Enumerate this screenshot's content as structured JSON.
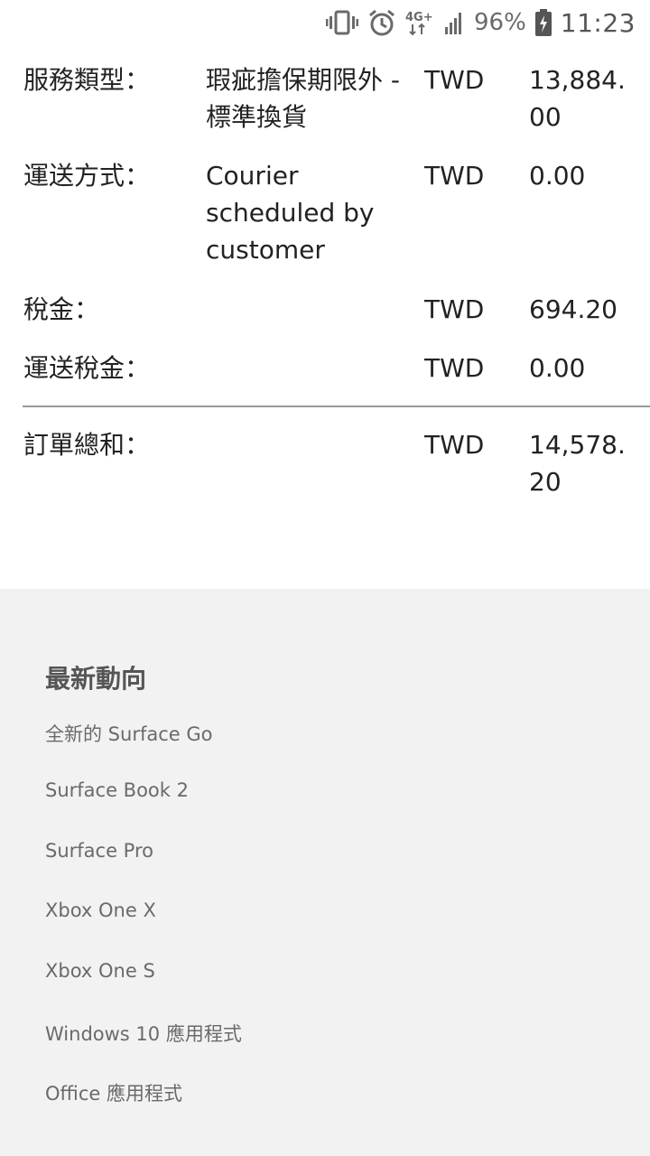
{
  "status_bar": {
    "battery_percent": "96%",
    "time": "11:23",
    "network": "4G+",
    "icons": [
      "vibrate-icon",
      "alarm-icon",
      "network-4g-icon",
      "signal-icon",
      "battery-charging-icon"
    ]
  },
  "order_summary": {
    "rows": [
      {
        "label": "服務類型：",
        "desc": "瑕疵擔保期限外 - 標準換貨",
        "currency": "TWD",
        "amount": "13,884.00"
      },
      {
        "label": "運送方式：",
        "desc": "Courier scheduled by customer",
        "currency": "TWD",
        "amount": "0.00"
      },
      {
        "label": "稅金：",
        "desc": "",
        "currency": "TWD",
        "amount": "694.20"
      },
      {
        "label": "運送稅金：",
        "desc": "",
        "currency": "TWD",
        "amount": "0.00"
      }
    ],
    "total": {
      "label": "訂單總和：",
      "currency": "TWD",
      "amount": "14,578.20"
    }
  },
  "footer": {
    "title": "最新動向",
    "links": [
      "全新的 Surface Go",
      "Surface Book 2",
      "Surface Pro",
      "Xbox One X",
      "Xbox One S",
      "Windows 10 應用程式",
      "Office 應用程式"
    ]
  },
  "colors": {
    "text": "#222222",
    "muted": "#6a6a6a",
    "footer_bg": "#f2f2f2",
    "divider": "#9a9a9a"
  }
}
